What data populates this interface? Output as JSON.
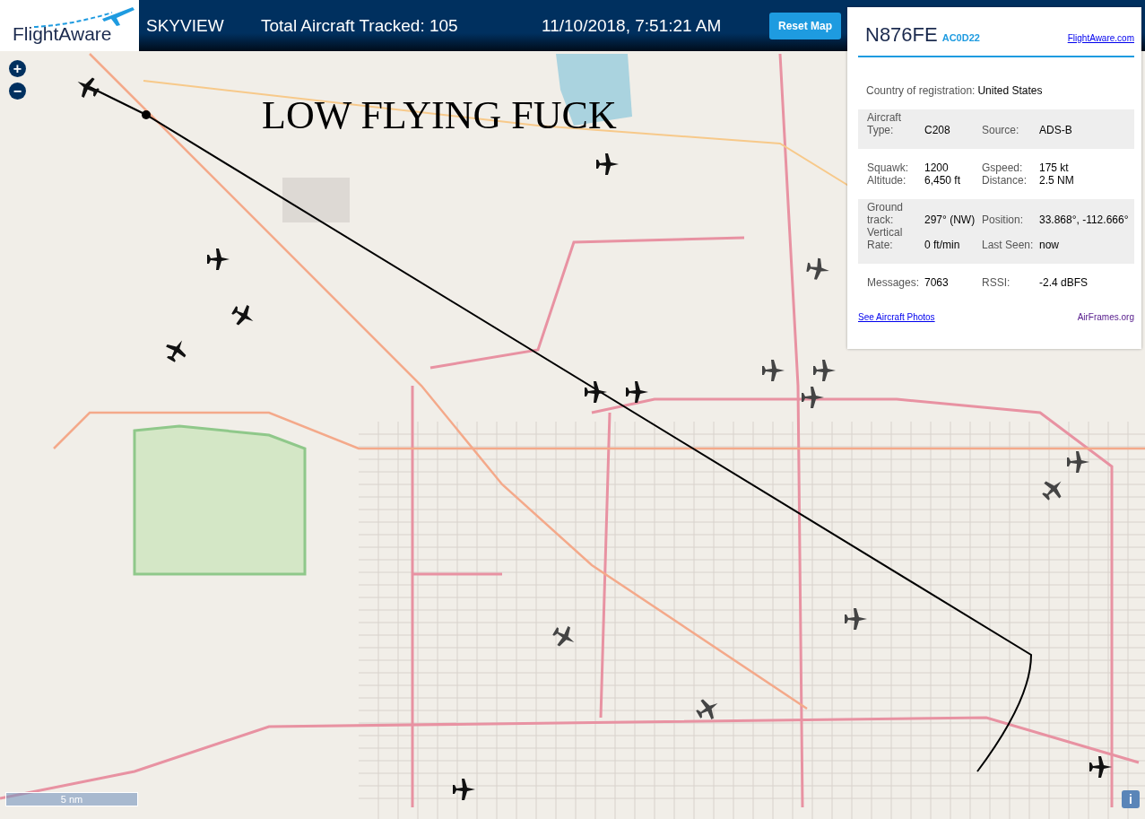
{
  "header": {
    "logo_text": "FlightAware",
    "site_name": "SKYVIEW",
    "aircraft_count": "Total Aircraft Tracked: 105",
    "datetime": "11/10/2018, 7:51:21 AM",
    "reset_button": "Reset Map"
  },
  "map": {
    "zoom_in": "+",
    "zoom_out": "−",
    "overlay_caption": "LOW FLYING FUCK",
    "scale": "5 nm",
    "info_button": "i"
  },
  "info_panel": {
    "registration": "N876FE",
    "hex": "AC0D22",
    "site_link": "FlightAware.com",
    "country_label": "Country of registration:",
    "country": "United States",
    "sections": [
      {
        "shaded": true,
        "rows": [
          [
            {
              "label": "Aircraft Type:",
              "value": "C208"
            },
            {
              "label": "Source:",
              "value": "ADS-B"
            }
          ]
        ]
      },
      {
        "shaded": false,
        "rows": [
          [
            {
              "label": "Squawk:",
              "value": "1200"
            },
            {
              "label": "Gspeed:",
              "value": "175 kt"
            }
          ],
          [
            {
              "label": "Altitude:",
              "value": "6,450 ft"
            },
            {
              "label": "Distance:",
              "value": "2.5 NM"
            }
          ]
        ]
      },
      {
        "shaded": true,
        "rows": [
          [
            {
              "label": "Ground track:",
              "value": "297° (NW)"
            },
            {
              "label": "Position:",
              "value": "33.868°, -112.666°"
            }
          ],
          [
            {
              "label": "Vertical Rate:",
              "value": "0 ft/min"
            },
            {
              "label": "Last Seen:",
              "value": "now"
            }
          ]
        ]
      },
      {
        "shaded": false,
        "rows": [
          [
            {
              "label": "Messages:",
              "value": "7063"
            },
            {
              "label": "RSSI:",
              "value": "-2.4 dBFS"
            }
          ]
        ]
      }
    ],
    "photos_link": "See Aircraft Photos",
    "airframes_link": "AirFrames.org"
  }
}
